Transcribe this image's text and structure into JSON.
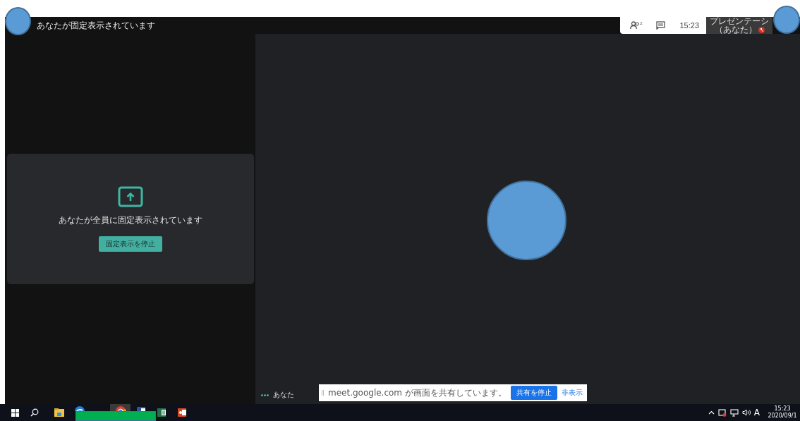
{
  "top_bar": {
    "title": "あなたが固定表示されています",
    "participant_count": "2",
    "clock": "15:23",
    "presentation_tile": {
      "line_1": "プレゼンテーシ",
      "line_2": "（あなた）",
      "muted": true
    }
  },
  "pinned_card": {
    "message": "あなたが全員に固定表示されています",
    "button": "固定表示を停止"
  },
  "main_tile": {
    "name": "あなた"
  },
  "share_bar": {
    "message": "meet.google.com が画面を共有しています。",
    "stop_button": "共有を停止",
    "hide_link": "非表示"
  },
  "taskbar": {
    "apps": [
      {
        "kind": "folder",
        "covered": false
      },
      {
        "kind": "edge",
        "covered": true
      },
      {
        "kind": "chrome",
        "covered": true
      },
      {
        "kind": "word",
        "covered": true
      },
      {
        "kind": "excel",
        "covered": false
      },
      {
        "kind": "powerpoint",
        "covered": false
      }
    ],
    "ime": "A",
    "time": "15:23",
    "date": "2020/09/1"
  }
}
